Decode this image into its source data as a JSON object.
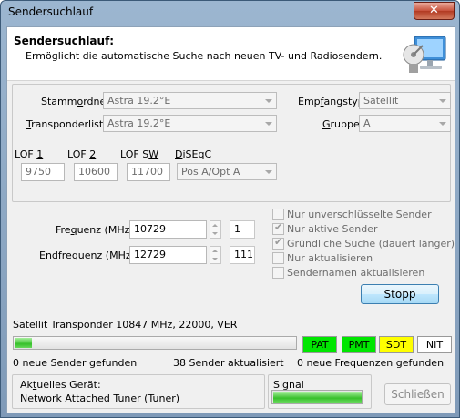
{
  "window": {
    "title": "Sendersuchlauf"
  },
  "header": {
    "title": "Sendersuchlauf:",
    "description": "Ermöglicht die automatische Suche nach neuen TV- und Radiosendern."
  },
  "settings": {
    "stammordner": {
      "label_pre": "Stamm",
      "label_u": "o",
      "label_post": "rdner",
      "value": "Astra 19.2°E"
    },
    "transponderliste": {
      "label_pre": "",
      "label_u": "T",
      "label_post": "ransponderliste",
      "value": "Astra 19.2°E"
    },
    "empfangstyp": {
      "label_pre": "Emp",
      "label_u": "f",
      "label_post": "angstyp",
      "value": "Satellit"
    },
    "gruppe": {
      "label_pre": "",
      "label_u": "G",
      "label_post": "ruppe",
      "value": "A"
    },
    "lof1": {
      "label_pre": "LOF ",
      "label_u": "1",
      "value": "9750"
    },
    "lof2": {
      "label_pre": "LOF ",
      "label_u": "2",
      "value": "10600"
    },
    "lofsw": {
      "label_pre": "LOF S",
      "label_u": "W",
      "value": "11700"
    },
    "diseqc": {
      "label_pre": "",
      "label_u": "D",
      "label_post": "iSEqC",
      "value": "Pos A/Opt A"
    }
  },
  "scan": {
    "frequenz": {
      "label_pre": "Fre",
      "label_u": "q",
      "label_post": "uenz (MHz)",
      "value": "10729",
      "step": "1"
    },
    "endfrequenz": {
      "label_pre": "",
      "label_u": "E",
      "label_post": "ndfrequenz (MHz)",
      "value": "12729",
      "step": "111"
    }
  },
  "options": [
    {
      "label": "Nur unverschlüsselte Sender",
      "checked": false
    },
    {
      "label": "Nur aktive Sender",
      "checked": true
    },
    {
      "label": "Gründliche Suche (dauert länger)",
      "checked": true
    },
    {
      "label": "Nur aktualisieren",
      "checked": false
    },
    {
      "label": "Sendernamen aktualisieren",
      "checked": false
    }
  ],
  "stopp_label": "Stopp",
  "status": {
    "transponder": "Satellit Transponder 10847 MHz, 22000, VER",
    "progress": 0.06,
    "tables": [
      {
        "label": "PAT",
        "color": "#00e600"
      },
      {
        "label": "PMT",
        "color": "#00e600"
      },
      {
        "label": "SDT",
        "color": "#ffff00"
      },
      {
        "label": "NIT",
        "color": "#ffffff"
      }
    ],
    "new_senders": "0 neue Sender gefunden",
    "updated_senders": "38 Sender aktualisiert",
    "new_frequencies": "0 neue Frequenzen gefunden"
  },
  "device": {
    "label_pre": "Ak",
    "label_u": "t",
    "label_post": "uelles Gerät:",
    "value": "Network Attached Tuner (Tuner)"
  },
  "signal": {
    "label": "Signal",
    "level": 0.99
  },
  "close_label": "Schließen"
}
